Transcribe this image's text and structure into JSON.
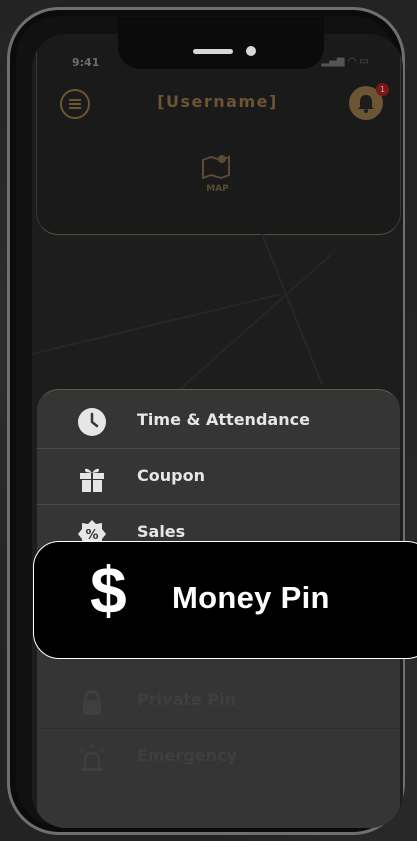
{
  "status": {
    "time": "9:41"
  },
  "header": {
    "title": "[Username]",
    "notification_count": "1"
  },
  "map": {
    "label": "MAP"
  },
  "menu": {
    "items": [
      {
        "label": "Time & Attendance",
        "icon": "clock-icon"
      },
      {
        "label": "Coupon",
        "icon": "gift-icon"
      },
      {
        "label": "Sales",
        "icon": "percent-badge-icon"
      },
      {
        "label": "Private Pin",
        "icon": "lock-icon"
      },
      {
        "label": "Emergency",
        "icon": "siren-icon"
      }
    ]
  },
  "highlight": {
    "symbol": "$",
    "label": "Money Pin"
  },
  "colors": {
    "accent": "#6b5532",
    "sheet": "#353535",
    "callout_bg": "#000000"
  }
}
